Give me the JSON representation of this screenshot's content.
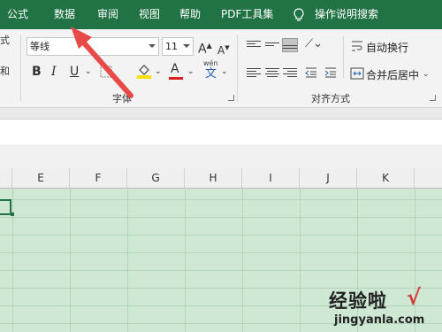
{
  "tabs": [
    {
      "label": "公式"
    },
    {
      "label": "数据"
    },
    {
      "label": "审阅"
    },
    {
      "label": "视图"
    },
    {
      "label": "帮助"
    },
    {
      "label": "PDF工具集"
    }
  ],
  "tell_me": {
    "label": "操作说明搜索",
    "icon": "lightbulb-icon"
  },
  "clipboard_fragment": {
    "top": "式",
    "bottom": "和"
  },
  "font_group": {
    "label": "字体",
    "font_name": "等线",
    "font_size": "11",
    "grow_label": "A",
    "shrink_label": "A",
    "bold": "B",
    "italic": "I",
    "underline": "U",
    "font_color_label": "A",
    "font_color": "#e02020",
    "highlight_color": "#f7e000",
    "phonetic_label": "文",
    "phonetic_top": "wén"
  },
  "alignment_group": {
    "label": "对齐方式",
    "wrap_text": "自动换行",
    "merge_center": "合并后居中"
  },
  "columns": [
    "E",
    "F",
    "G",
    "H",
    "I",
    "J",
    "K"
  ],
  "watermark": {
    "title": "经验啦",
    "check": "√",
    "url": "jingyanla.com"
  },
  "colors": {
    "tab_bar": "#217346",
    "sheet_fill": "#cfe8d4",
    "arrow": "#e84a4a"
  }
}
